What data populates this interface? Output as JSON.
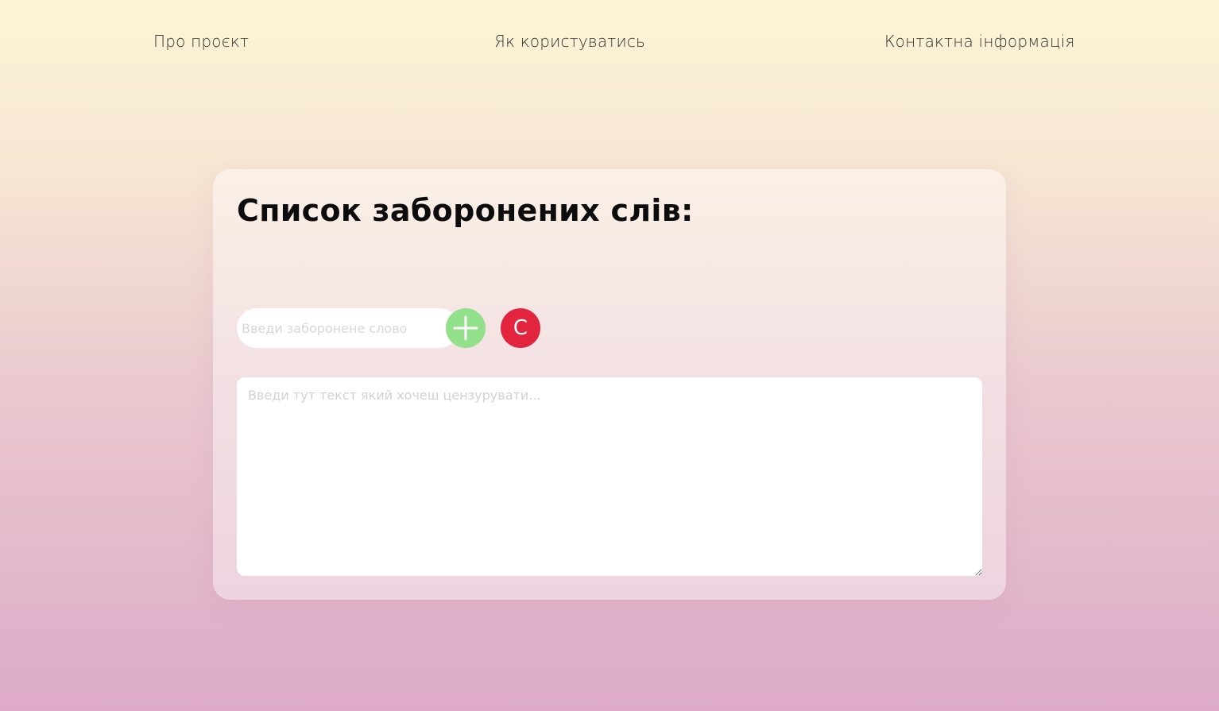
{
  "nav": {
    "items": [
      {
        "label": "Про проєкт"
      },
      {
        "label": "Як користуватись"
      },
      {
        "label": "Контактна інформація"
      }
    ]
  },
  "card": {
    "title": "Список заборонених слів:",
    "word_input": {
      "placeholder": "Введи заборонене слово",
      "value": ""
    },
    "add_button": {
      "icon": "plus-icon",
      "color": "#92e08a"
    },
    "clear_button": {
      "label": "C",
      "color": "#e3243e"
    },
    "text_area": {
      "placeholder": "Введи тут текст який хочеш цензурувати...",
      "value": ""
    }
  }
}
